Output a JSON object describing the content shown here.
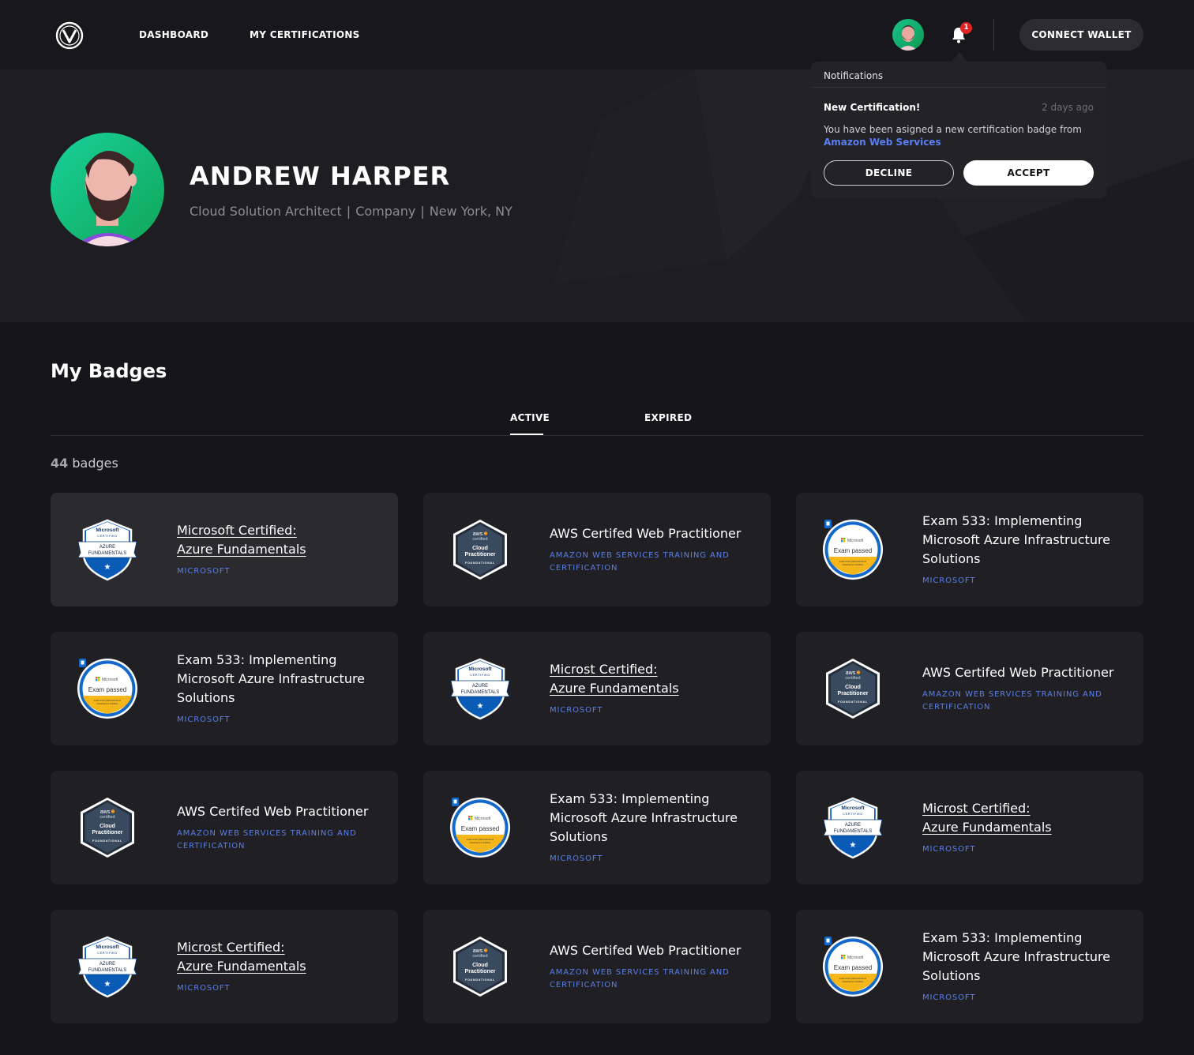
{
  "nav": {
    "dashboard": "DASHBOARD",
    "certifications": "MY CERTIFICATIONS",
    "connect_wallet": "CONNECT WALLET",
    "notification_count": "1"
  },
  "profile": {
    "name": "ANDREW HARPER",
    "role": "Cloud Solution Architect",
    "separator": "|",
    "company": "Company",
    "location": "New York, NY"
  },
  "notification": {
    "panel_title": "Notifications",
    "heading": "New Certification!",
    "time": "2 days ago",
    "body": "You have been asigned a new certification badge from",
    "issuer": "Amazon Web Services",
    "decline": "DECLINE",
    "accept": "ACCEPT"
  },
  "badges": {
    "title": "My Badges",
    "tabs": {
      "active": "ACTIVE",
      "expired": "EXPIRED"
    },
    "count_number": "44",
    "count_label": "badges",
    "cards": [
      {
        "type": "azure",
        "title": "Microsoft Certified: Azure Fundamentals",
        "issuer": "MICROSOFT",
        "underlined": true
      },
      {
        "type": "aws",
        "title": "AWS Certifed Web Practitioner",
        "issuer": "AMAZON WEB SERVICES TRAINING AND CERTIFICATION",
        "underlined": false
      },
      {
        "type": "exam",
        "title": "Exam 533: Implementing Microsoft Azure Infrastructure Solutions",
        "issuer": "MICROSOFT",
        "underlined": false
      },
      {
        "type": "exam",
        "title": "Exam 533: Implementing Microsoft Azure Infrastructure Solutions",
        "issuer": "MICROSOFT",
        "underlined": false
      },
      {
        "type": "azure",
        "title": "Microst Certified: Azure Fundamentals",
        "issuer": "MICROSOFT",
        "underlined": true
      },
      {
        "type": "aws",
        "title": "AWS Certifed Web Practitioner",
        "issuer": "AMAZON WEB SERVICES TRAINING AND CERTIFICATION",
        "underlined": false
      },
      {
        "type": "aws",
        "title": "AWS Certifed Web Practitioner",
        "issuer": "AMAZON WEB SERVICES TRAINING AND CERTIFICATION",
        "underlined": false
      },
      {
        "type": "exam",
        "title": "Exam 533: Implementing Microsoft Azure Infrastructure Solutions",
        "issuer": "MICROSOFT",
        "underlined": false
      },
      {
        "type": "azure",
        "title": "Microst Certified: Azure Fundamentals",
        "issuer": "MICROSOFT",
        "underlined": true
      },
      {
        "type": "azure",
        "title": "Microst Certified: Azure Fundamentals",
        "issuer": "MICROSOFT",
        "underlined": true
      },
      {
        "type": "aws",
        "title": "AWS Certifed Web Practitioner",
        "issuer": "AMAZON WEB SERVICES TRAINING AND CERTIFICATION",
        "underlined": false
      },
      {
        "type": "exam",
        "title": "Exam 533: Implementing Microsoft Azure Infrastructure Solutions",
        "issuer": "MICROSOFT",
        "underlined": false
      }
    ]
  },
  "badge_art": {
    "azure": {
      "top": "Microsoft",
      "top_sub": "CERTIFIED",
      "ribbon": "AZURE FUNDAMENTALS"
    },
    "aws": {
      "logo": "aws",
      "logo_sub": "certified",
      "line1": "Cloud",
      "line2": "Practitioner",
      "foot": "FOUNDATIONAL"
    },
    "exam": {
      "brand": "Microsoft",
      "label": "Exam passed",
      "band": "Implementing Microsoft Azure Infrastructure Solutions"
    }
  },
  "colors": {
    "accent_link": "#5b7ff2",
    "issuer_text": "#5a7fe8",
    "badge_blue": "#0a5bb5",
    "notification_red": "#e02424",
    "avatar_green": "#1fc97a"
  },
  "icons": [
    "logo-icon",
    "bell-icon",
    "avatar"
  ]
}
